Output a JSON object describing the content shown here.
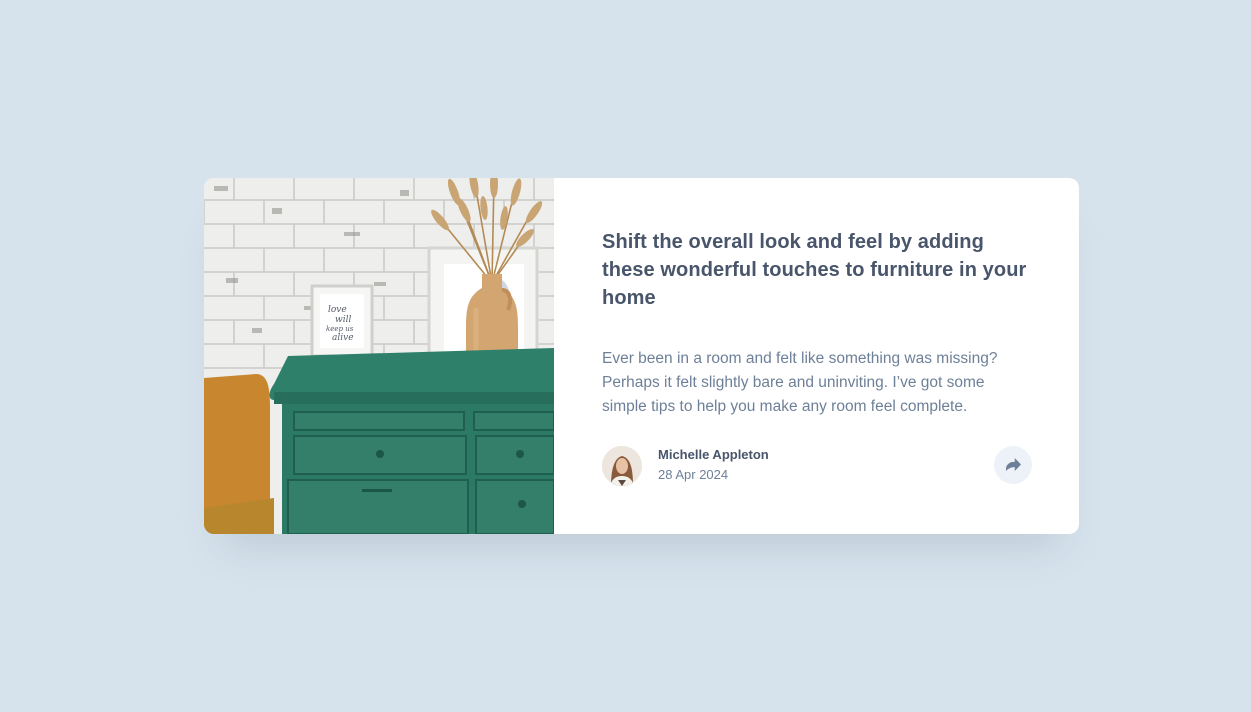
{
  "article": {
    "title": "Shift the overall look and feel by adding these wonderful touches to furniture in your home",
    "excerpt": "Ever been in a room and felt like something was missing? Perhaps it felt slightly bare and uninviting. I’ve got some simple tips to help you make any room feel complete.",
    "image_alt": "green drawers with a vase of dried grass and picture frames",
    "frame_text": [
      "love",
      "will",
      "keep us",
      "alive"
    ]
  },
  "author": {
    "name": "Michelle Appleton",
    "date": "28 Apr 2024",
    "avatar_icon": "avatar-photo"
  },
  "share": {
    "icon": "share-arrow-icon",
    "aria_label": "Share"
  },
  "colors": {
    "background": "#d6e3ed",
    "card": "#ffffff",
    "title": "#48556a",
    "body_text": "#6e8098",
    "share_button": "#ecf2f8",
    "share_icon": "#6e8098"
  }
}
